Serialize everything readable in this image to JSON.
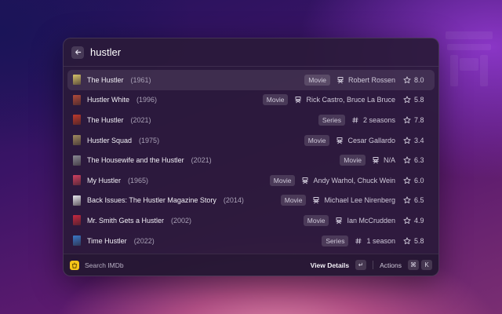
{
  "search": {
    "value": "hustler"
  },
  "results": [
    {
      "title": "The Hustler",
      "year": "(1961)",
      "type": "Movie",
      "meta_icon": "director-chair-icon",
      "meta": "Robert Rossen",
      "rating": "8.0",
      "poster_color": "#d8c46a",
      "selected": true
    },
    {
      "title": "Hustler White",
      "year": "(1996)",
      "type": "Movie",
      "meta_icon": "director-chair-icon",
      "meta": "Rick Castro, Bruce La Bruce",
      "rating": "5.8",
      "poster_color": "#b24a3a",
      "selected": false
    },
    {
      "title": "The Hustler",
      "year": "(2021)",
      "type": "Series",
      "meta_icon": "hash-icon",
      "meta": "2 seasons",
      "rating": "7.8",
      "poster_color": "#c0392b",
      "selected": false
    },
    {
      "title": "Hustler Squad",
      "year": "(1975)",
      "type": "Movie",
      "meta_icon": "director-chair-icon",
      "meta": "Cesar Gallardo",
      "rating": "3.4",
      "poster_color": "#a08a60",
      "selected": false
    },
    {
      "title": "The Housewife and the Hustler",
      "year": "(2021)",
      "type": "Movie",
      "meta_icon": "director-chair-icon",
      "meta": "N/A",
      "rating": "6.3",
      "poster_color": "#8a8a94",
      "selected": false
    },
    {
      "title": "My Hustler",
      "year": "(1965)",
      "type": "Movie",
      "meta_icon": "director-chair-icon",
      "meta": "Andy Warhol, Chuck Wein",
      "rating": "6.0",
      "poster_color": "#d04060",
      "selected": false
    },
    {
      "title": "Back Issues: The Hustler Magazine Story",
      "year": "(2014)",
      "type": "Movie",
      "meta_icon": "director-chair-icon",
      "meta": "Michael Lee Nirenberg",
      "rating": "6.5",
      "poster_color": "#e8e8ee",
      "selected": false
    },
    {
      "title": "Mr. Smith Gets a Hustler",
      "year": "(2002)",
      "type": "Movie",
      "meta_icon": "director-chair-icon",
      "meta": "Ian McCrudden",
      "rating": "4.9",
      "poster_color": "#c82840",
      "selected": false
    },
    {
      "title": "Time Hustler",
      "year": "(2022)",
      "type": "Series",
      "meta_icon": "hash-icon",
      "meta": "1 season",
      "rating": "5.8",
      "poster_color": "#3a78c8",
      "selected": false
    }
  ],
  "footer": {
    "icon": "imdb-icon",
    "label": "Search IMDb",
    "primary_action": "View Details",
    "primary_key": "↵",
    "actions_label": "Actions",
    "actions_keys": [
      "⌘",
      "K"
    ]
  }
}
